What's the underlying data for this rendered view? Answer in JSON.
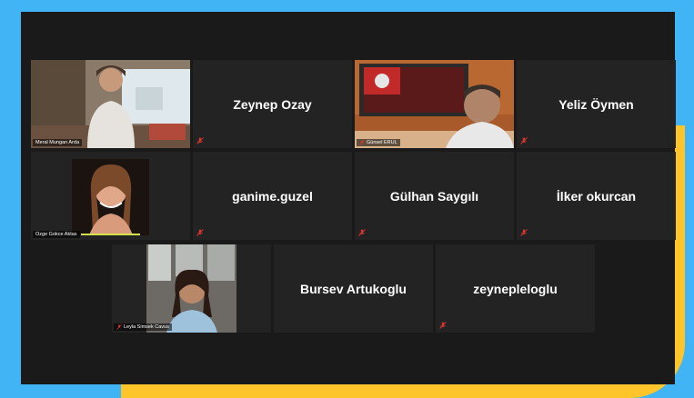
{
  "theme": {
    "background_blue": "#41b4f5",
    "background_yellow": "#fdc52a",
    "window": "#1a1a1a",
    "tile": "#232323",
    "active_speaker": "#d7e24b",
    "mute_red": "#d8362f"
  },
  "participants": [
    {
      "name": "Meral Mungan Arda",
      "type": "video",
      "muted": false,
      "active": true
    },
    {
      "name": "Zeynep Ozay",
      "type": "name",
      "muted": true
    },
    {
      "name": "Günsel ERUL",
      "type": "video",
      "muted": true
    },
    {
      "name": "Yeliz Öymen",
      "type": "name",
      "muted": true
    },
    {
      "name": "Ozge Gokce Aktas",
      "type": "video",
      "muted": false
    },
    {
      "name": "ganime.guzel",
      "type": "name",
      "muted": true
    },
    {
      "name": "Gülhan Saygılı",
      "type": "name",
      "muted": true
    },
    {
      "name": "İlker okurcan",
      "type": "name",
      "muted": true
    },
    {
      "name": "Leyla Simsek Cavus",
      "type": "video",
      "muted": true
    },
    {
      "name": "Bursev Artukoglu",
      "type": "name",
      "muted": false
    },
    {
      "name": "zeynepleloglu",
      "type": "name",
      "muted": true
    }
  ]
}
